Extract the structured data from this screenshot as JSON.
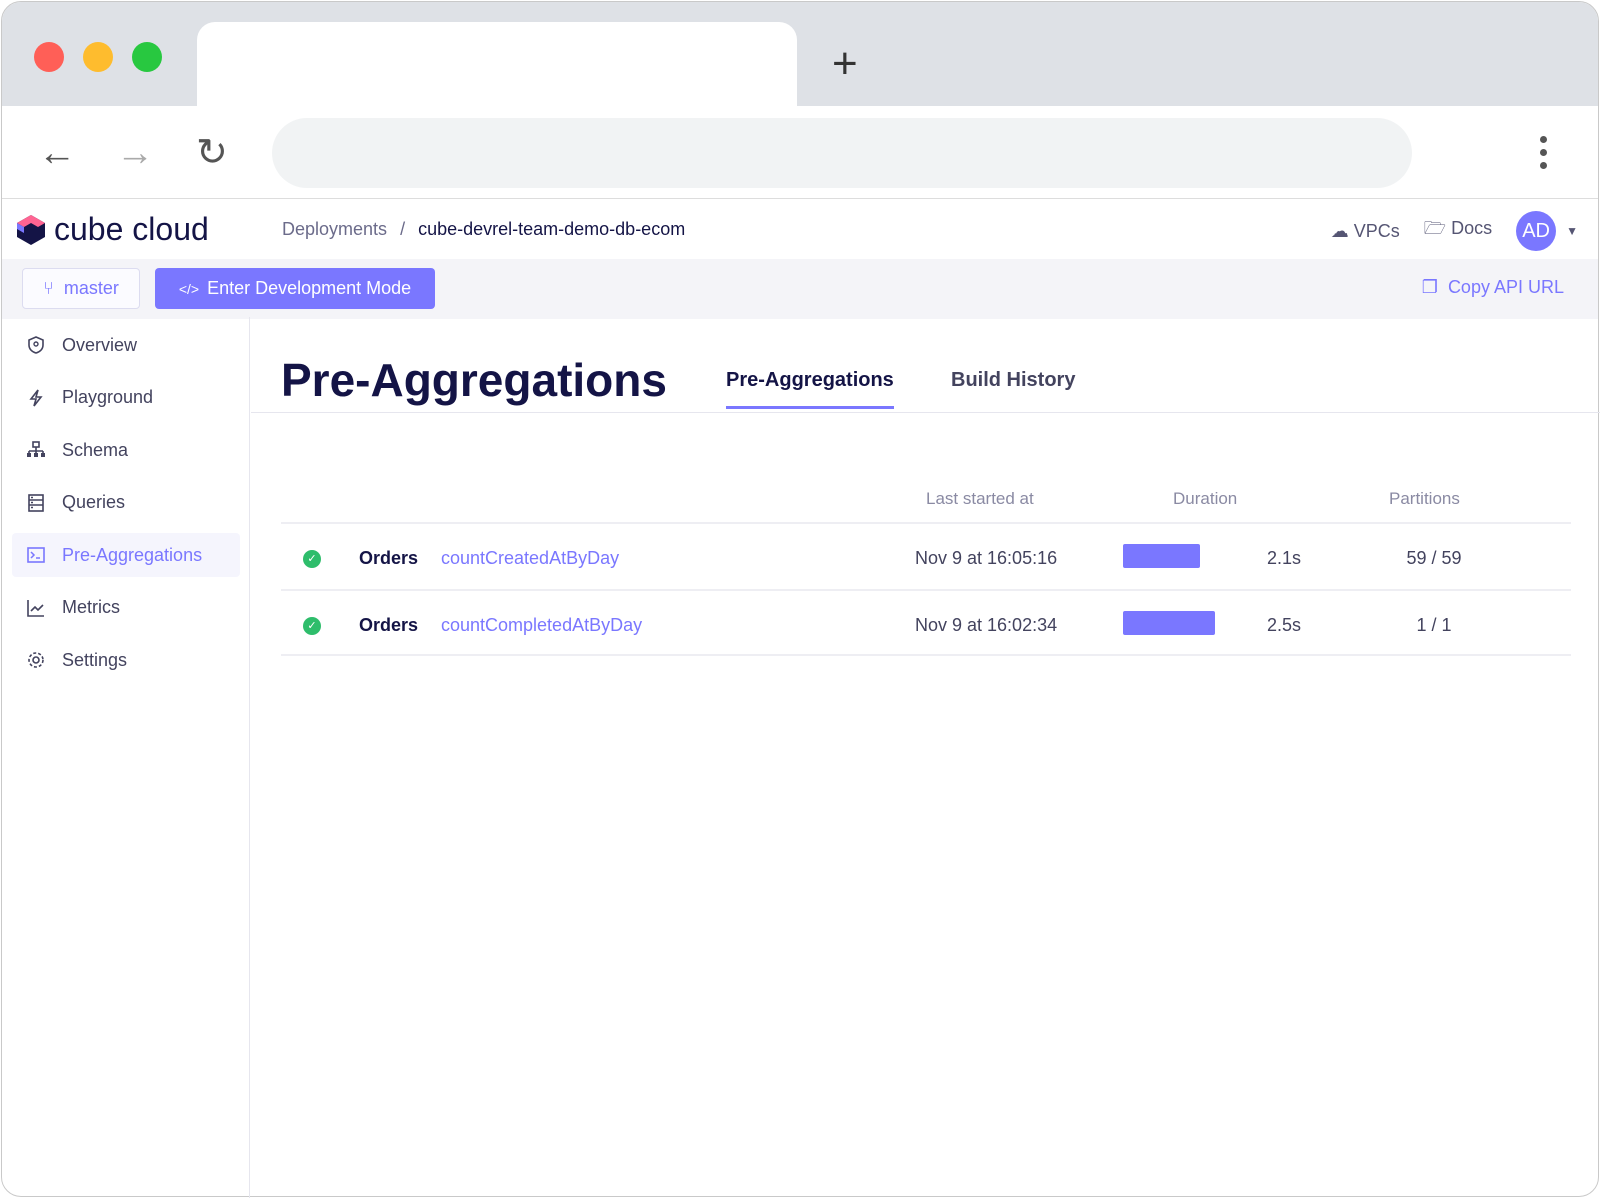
{
  "app": {
    "logo_text": "cube cloud",
    "accent": "#7a77ff"
  },
  "breadcrumb": {
    "parent": "Deployments",
    "separator": "/",
    "current": "cube-devrel-team-demo-db-ecom"
  },
  "header_right": {
    "vpcs": "VPCs",
    "docs": "Docs",
    "avatar": "AD"
  },
  "toolbar": {
    "branch": "master",
    "dev_mode": "Enter Development Mode",
    "dev_icon": "</>",
    "copy_api": "Copy API URL"
  },
  "sidebar": {
    "items": [
      {
        "label": "Overview",
        "icon": "shield-icon"
      },
      {
        "label": "Playground",
        "icon": "lightning-icon"
      },
      {
        "label": "Schema",
        "icon": "hierarchy-icon"
      },
      {
        "label": "Queries",
        "icon": "list-icon"
      },
      {
        "label": "Pre-Aggregations",
        "icon": "terminal-icon",
        "active": true
      },
      {
        "label": "Metrics",
        "icon": "chart-icon"
      },
      {
        "label": "Settings",
        "icon": "gear-icon"
      }
    ]
  },
  "page": {
    "title": "Pre-Aggregations",
    "tabs": [
      {
        "label": "Pre-Aggregations",
        "active": true
      },
      {
        "label": "Build History"
      }
    ]
  },
  "table": {
    "columns": [
      "Last started at",
      "Duration",
      "Partitions"
    ],
    "rows": [
      {
        "status": "success",
        "cube": "Orders",
        "name": "countCreatedAtByDay",
        "last_started": "Nov 9 at 16:05:16",
        "duration": "2.1s",
        "duration_s": 2.1,
        "partitions": "59 / 59"
      },
      {
        "status": "success",
        "cube": "Orders",
        "name": "countCompletedAtByDay",
        "last_started": "Nov 9 at 16:02:34",
        "duration": "2.5s",
        "duration_s": 2.5,
        "partitions": "1 / 1"
      }
    ]
  }
}
